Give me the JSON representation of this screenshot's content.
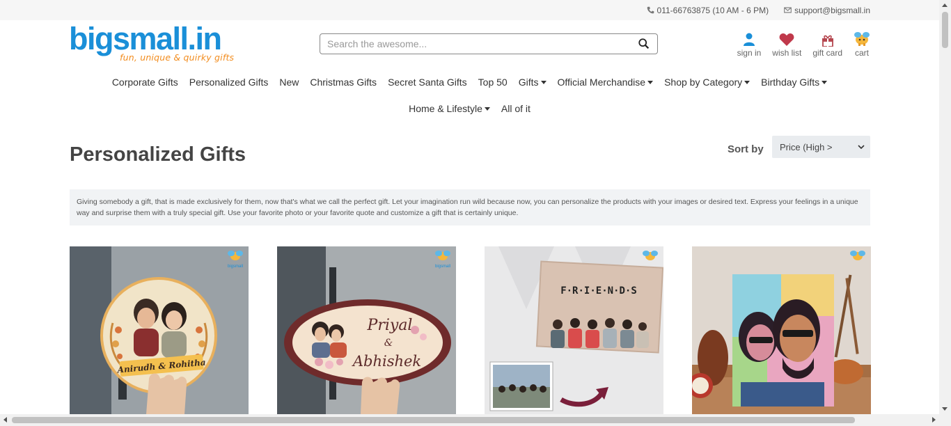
{
  "topbar": {
    "phone": "011-66763875 (10 AM - 6 PM)",
    "email": "support@bigsmall.in"
  },
  "logo": {
    "name": "bigsmall.in",
    "tagline": "fun, unique & quirky gifts"
  },
  "search": {
    "placeholder": "Search the awesome..."
  },
  "user_links": [
    {
      "label": "sign in",
      "icon": "user-icon"
    },
    {
      "label": "wish list",
      "icon": "heart-icon"
    },
    {
      "label": "gift card",
      "icon": "gift-icon"
    },
    {
      "label": "cart",
      "icon": "cart-icon"
    }
  ],
  "nav": {
    "row1": [
      "Corporate Gifts",
      "Personalized Gifts",
      "New",
      "Christmas Gifts",
      "Secret Santa Gifts",
      "Top 50",
      "Gifts",
      "Official Merchandise",
      "Shop by Category",
      "Birthday Gifts"
    ],
    "row2": [
      "Home & Lifestyle",
      "All of it"
    ]
  },
  "page": {
    "title": "Personalized Gifts",
    "sort_label": "Sort by",
    "sort_value": "Price (High >",
    "description": "Giving somebody a gift, that is made exclusively for them, now that's what we call the perfect gift. Let your imagination run wild because now, you can personalize the products with your images or desired text. Express your feelings in a unique way and surprise them with a truly special gift. Use your favorite photo or your favorite quote and customize a gift that is certainly unique."
  },
  "products": [
    {
      "label_text": "Anirudh & Rohitha"
    },
    {
      "name1": "Priyal",
      "amp": "&",
      "name2": "Abhishek"
    },
    {
      "label_text": "F·R·I·E·N·D·S"
    },
    {
      "label_text": ""
    }
  ],
  "colors": {
    "brand_blue": "#1a8fd8",
    "brand_orange": "#f28c1e",
    "heart": "#c0394b",
    "gift": "#b5464f"
  }
}
